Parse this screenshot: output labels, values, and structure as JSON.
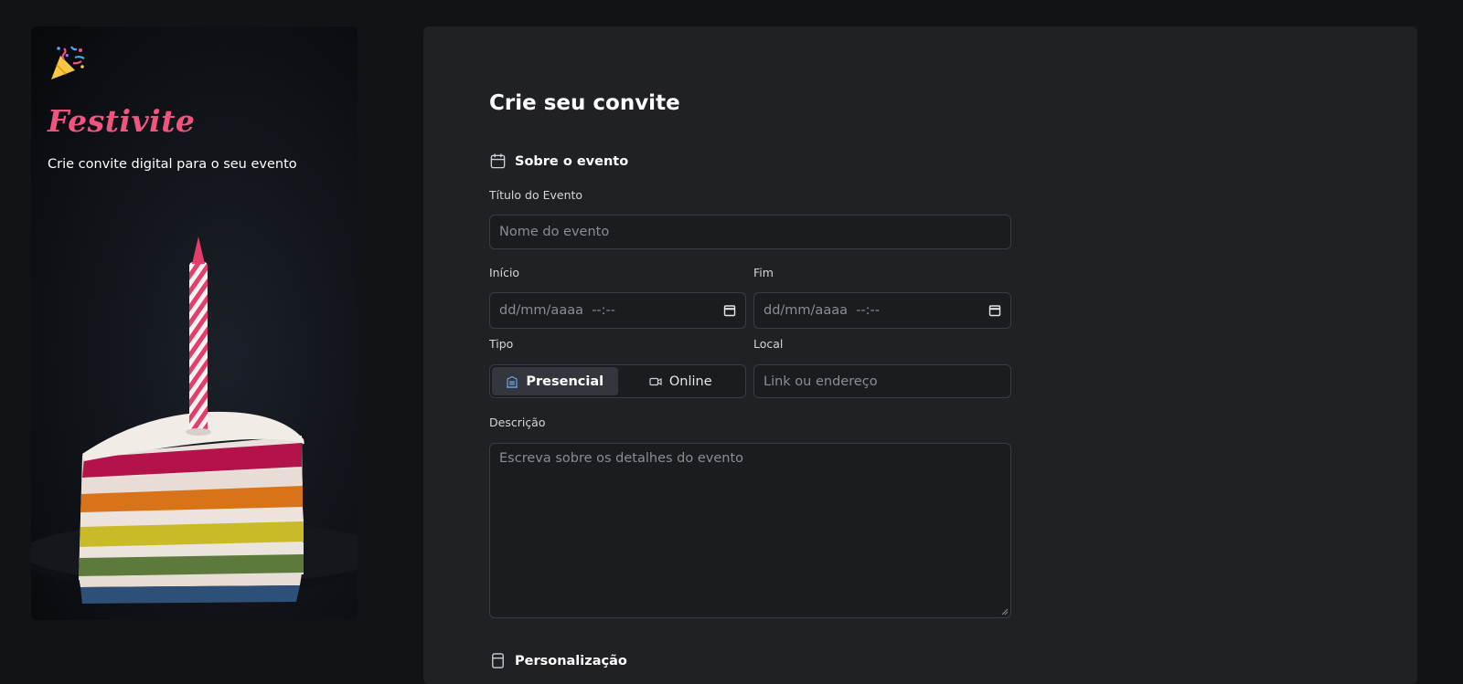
{
  "brand": {
    "name": "Festivite",
    "tagline": "Crie convite digital para o seu evento"
  },
  "form": {
    "title": "Crie seu convite",
    "section_event": "Sobre o evento",
    "section_custom": "Personalização",
    "event_title_label": "Título do Evento",
    "event_title_placeholder": "Nome do evento",
    "start_label": "Início",
    "start_placeholder": "dd/mm/aaaa  --:--",
    "end_label": "Fim",
    "end_placeholder": "dd/mm/aaaa  --:--",
    "type_label": "Tipo",
    "type_options": [
      "Presencial",
      "Online"
    ],
    "type_selected": "Presencial",
    "location_label": "Local",
    "location_placeholder": "Link ou endereço",
    "description_label": "Descrição",
    "description_placeholder": "Escreva sobre os detalhes do evento"
  },
  "colors": {
    "page_bg": "#121316",
    "panel_bg": "#1f2124",
    "brand_pink": "#f0557f",
    "input_border": "#393c41"
  },
  "icons": {
    "logo": "party-popper-icon",
    "section_event": "calendar-icon",
    "section_custom": "palette-icon",
    "date_picker": "calendar-icon",
    "presencial": "building-icon",
    "online": "video-icon"
  }
}
